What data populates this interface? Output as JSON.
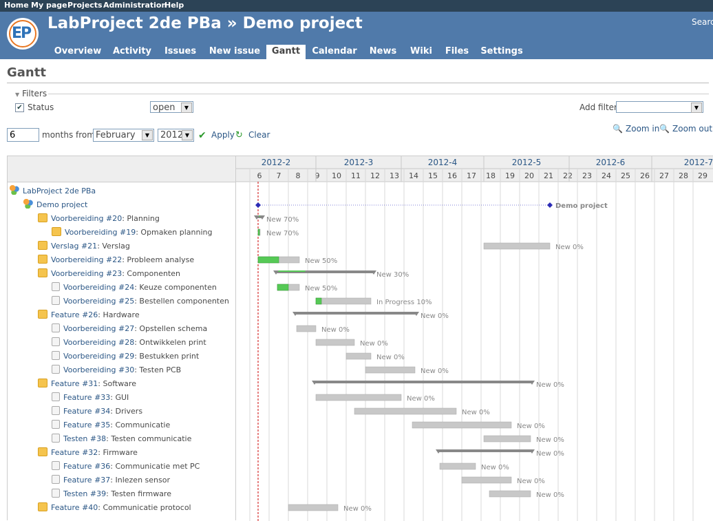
{
  "top_menu": [
    "Home",
    "My page",
    "Projects",
    "Administration",
    "Help"
  ],
  "header": {
    "logo_text": "EP",
    "title": "LabProject 2de PBa » Demo project",
    "search_label": "Search"
  },
  "tabs": [
    "Overview",
    "Activity",
    "Issues",
    "New issue",
    "Gantt",
    "Calendar",
    "News",
    "Wiki",
    "Files",
    "Settings"
  ],
  "selected_tab": "Gantt",
  "page_title": "Gantt",
  "filters": {
    "legend": "Filters",
    "status_label": "Status",
    "status_checked": true,
    "status_value": "open",
    "add_filter_label": "Add filter",
    "add_filter_value": ""
  },
  "range": {
    "months": "6",
    "months_from_label": "months from",
    "month": "February",
    "year": "2012",
    "apply": "Apply",
    "clear": "Clear",
    "zoom_in": "Zoom in",
    "zoom_out": "Zoom out"
  },
  "gantt": {
    "months": [
      "2012-2",
      "2012-3",
      "2012-4",
      "2012-5",
      "2012-6",
      "2012-7"
    ],
    "weeks": [
      "6",
      "7",
      "8",
      "9",
      "10",
      "11",
      "12",
      "13",
      "14",
      "15",
      "16",
      "17",
      "18",
      "19",
      "20",
      "21",
      "22",
      "23",
      "24",
      "25",
      "26",
      "27",
      "28",
      "29"
    ],
    "rows": [
      {
        "kind": "project",
        "text": "LabProject 2de PBa"
      },
      {
        "kind": "project",
        "text": "Demo project",
        "label": "Demo project"
      },
      {
        "kind": "task",
        "tracker": "Voorbereiding #20",
        "subject": "Planning",
        "label": "New 70%"
      },
      {
        "kind": "task",
        "tracker": "Voorbereiding #19",
        "subject": "Opmaken planning",
        "label": "New 70%"
      },
      {
        "kind": "task",
        "tracker": "Verslag #21",
        "subject": "Verslag",
        "label": "New 0%"
      },
      {
        "kind": "task",
        "tracker": "Voorbereiding #22",
        "subject": "Probleem analyse",
        "label": "New 50%"
      },
      {
        "kind": "task",
        "tracker": "Voorbereiding #23",
        "subject": "Componenten",
        "label": "New 30%"
      },
      {
        "kind": "task",
        "tracker": "Voorbereiding #24",
        "subject": "Keuze componenten",
        "label": "New 50%"
      },
      {
        "kind": "task",
        "tracker": "Voorbereiding #25",
        "subject": "Bestellen componenten",
        "label": "In Progress 10%"
      },
      {
        "kind": "task",
        "tracker": "Feature #26",
        "subject": "Hardware",
        "label": "New 0%"
      },
      {
        "kind": "task",
        "tracker": "Voorbereiding #27",
        "subject": "Opstellen schema",
        "label": "New 0%"
      },
      {
        "kind": "task",
        "tracker": "Voorbereiding #28",
        "subject": "Ontwikkelen print",
        "label": "New 0%"
      },
      {
        "kind": "task",
        "tracker": "Voorbereiding #29",
        "subject": "Bestukken print",
        "label": "New 0%"
      },
      {
        "kind": "task",
        "tracker": "Voorbereiding #30",
        "subject": "Testen PCB",
        "label": "New 0%"
      },
      {
        "kind": "task",
        "tracker": "Feature #31",
        "subject": "Software",
        "label": "New 0%"
      },
      {
        "kind": "task",
        "tracker": "Feature #33",
        "subject": "GUI",
        "label": "New 0%"
      },
      {
        "kind": "task",
        "tracker": "Feature #34",
        "subject": "Drivers",
        "label": "New 0%"
      },
      {
        "kind": "task",
        "tracker": "Feature #35",
        "subject": "Communicatie",
        "label": "New 0%"
      },
      {
        "kind": "task",
        "tracker": "Testen #38",
        "subject": "Testen communicatie",
        "label": "New 0%"
      },
      {
        "kind": "task",
        "tracker": "Feature #32",
        "subject": "Firmware",
        "label": "New 0%"
      },
      {
        "kind": "task",
        "tracker": "Feature #36",
        "subject": "Communicatie met PC",
        "label": "New 0%"
      },
      {
        "kind": "task",
        "tracker": "Feature #37",
        "subject": "Inlezen sensor",
        "label": "New 0%"
      },
      {
        "kind": "task",
        "tracker": "Testen #39",
        "subject": "Testen firmware",
        "label": "New 0%"
      },
      {
        "kind": "task",
        "tracker": "Feature #40",
        "subject": "Communicatie protocol",
        "label": "New 0%"
      }
    ]
  },
  "colors": {
    "header_bg": "#507aaa",
    "top_menu_bg": "#2c4356",
    "link": "#2a5685",
    "done": "#56c956",
    "todo": "#c8c8c8",
    "parent_bar": "#888888",
    "today_line": "#cc0000"
  }
}
